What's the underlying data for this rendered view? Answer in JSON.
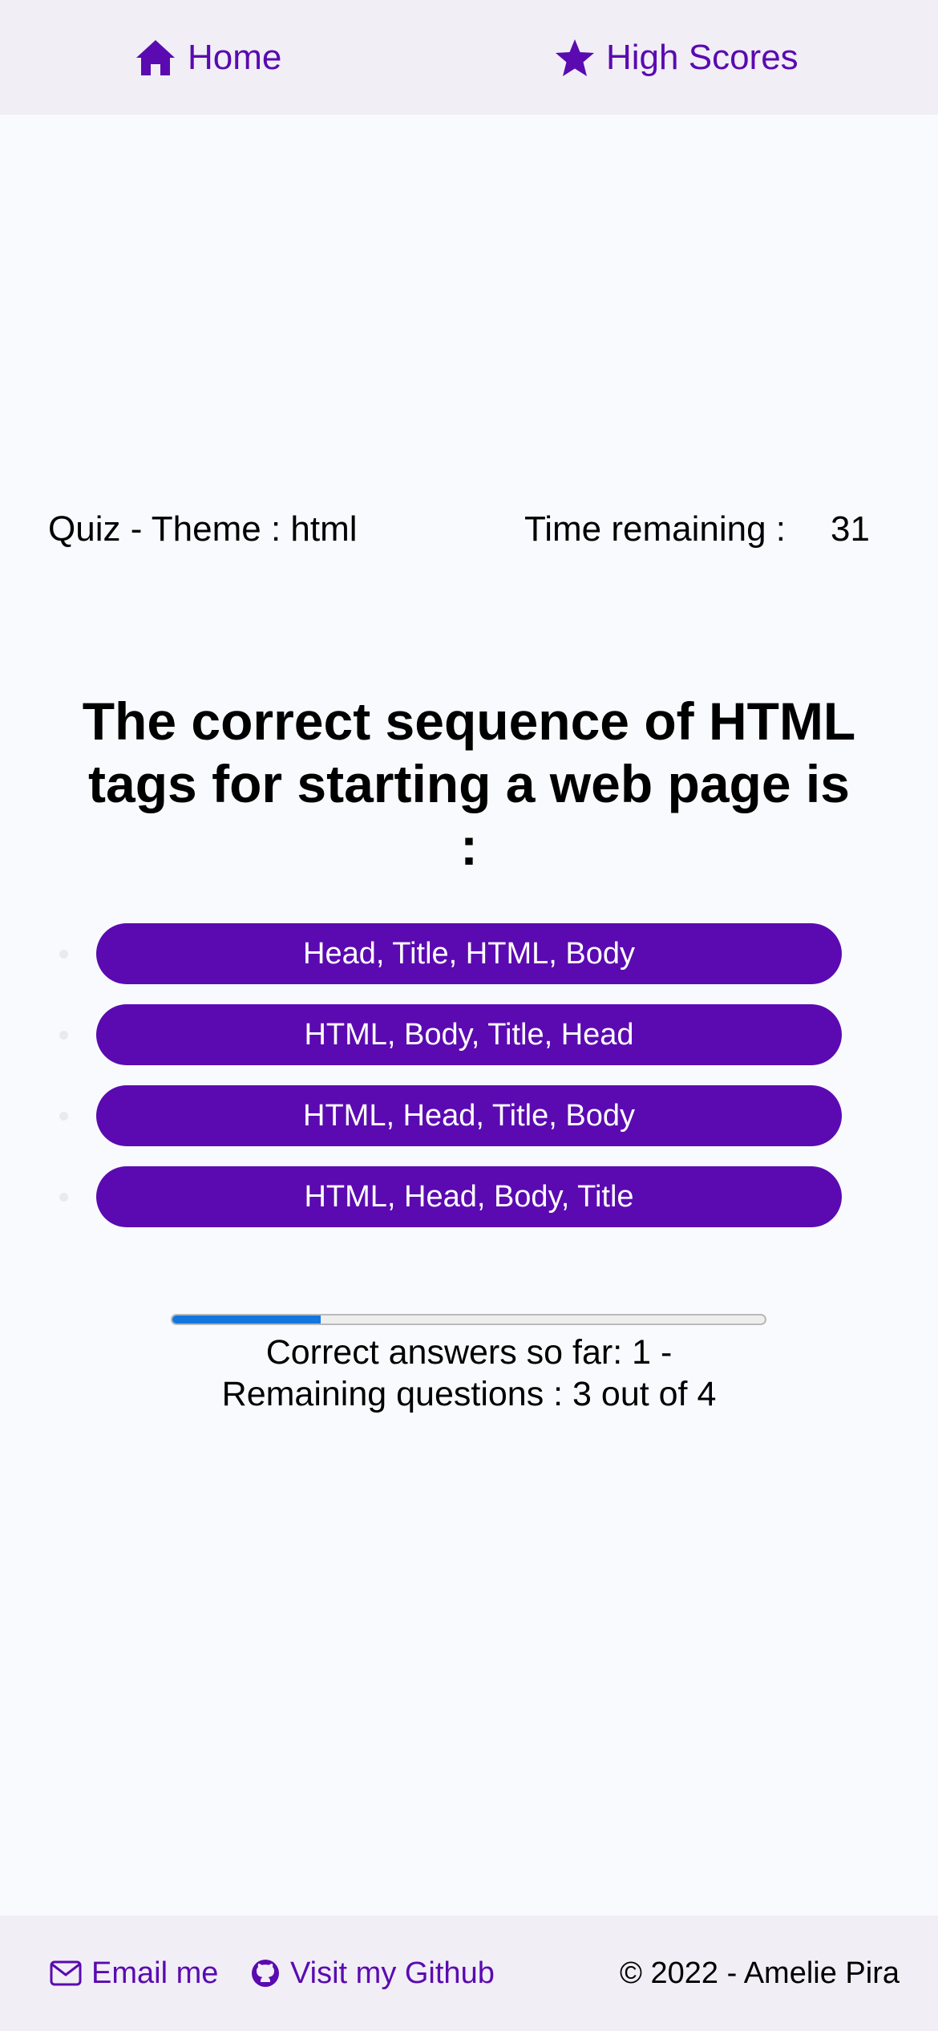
{
  "nav": {
    "home_label": "Home",
    "home_icon": "home-icon",
    "scores_label": "High Scores",
    "scores_icon": "star-icon",
    "link_color": "#5a0ab0"
  },
  "quiz": {
    "theme_text": "Quiz - Theme : html",
    "time_label": "Time remaining :",
    "time_value": "31"
  },
  "question": {
    "text": "The correct sequence of HTML tags for starting a web page is :"
  },
  "answers": [
    {
      "label": "Head, Title, HTML, Body"
    },
    {
      "label": "HTML, Body, Title, Head"
    },
    {
      "label": "HTML, Head, Title, Body"
    },
    {
      "label": "HTML, Head, Body, Title"
    }
  ],
  "progress": {
    "value": 1,
    "max": 4,
    "fill_color": "#1376de",
    "line1": "Correct answers so far: 1 -",
    "line2": "Remaining questions : 3 out of 4"
  },
  "footer": {
    "email_label": "Email me",
    "email_icon": "envelope-icon",
    "github_label": "Visit my Github",
    "github_icon": "github-icon",
    "copyright": "© 2022 - Amelie Pira"
  },
  "colors": {
    "accent": "#5b0ab1",
    "header_bg": "#f1eef6",
    "page_bg": "#f9fafd"
  }
}
